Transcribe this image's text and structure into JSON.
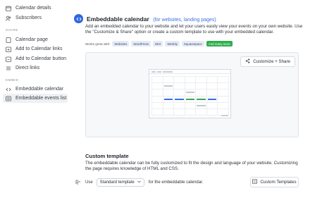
{
  "sidebar": {
    "items_top": [
      {
        "label": "Calendar details",
        "icon": "calendar-icon"
      },
      {
        "label": "Subscribers",
        "icon": "users-icon"
      }
    ],
    "share_section": "SHARE",
    "share_items": [
      {
        "label": "Calendar page",
        "icon": "page-icon"
      },
      {
        "label": "Add to Calendar links",
        "icon": "link-icon"
      },
      {
        "label": "Add to Calendar button",
        "icon": "button-icon"
      },
      {
        "label": "Direct links",
        "icon": "list-icon"
      }
    ],
    "embed_section": "EMBED",
    "embed_items": [
      {
        "label": "Embeddable calendar",
        "icon": "code-icon"
      },
      {
        "label": "Embeddable events list",
        "icon": "events-list-icon"
      }
    ]
  },
  "header": {
    "title": "Embeddable calendar",
    "subtitle": "(for websites, landing pages)",
    "description": "Add an embedded calendar to your website and let your users easily view your events on your own website. Use the \"Customize & Share\" option or create a custom template to use with your embedded calendar."
  },
  "works_with": {
    "label": "Works great with:",
    "platforms": [
      "Websites",
      "WordPress",
      "WIX",
      "Weebly",
      "Squarespace"
    ],
    "more": "And many more"
  },
  "preview": {
    "share_button": "Customize + Share"
  },
  "custom_template": {
    "title": "Custom template",
    "description": "The embeddable calendar can be fully customized to fit the design and language of your website. Customizing the page requires knowledge of HTML and CSS.",
    "use_label": "Use",
    "selected_template": "Standard template",
    "suffix": "for the embeddable calendar.",
    "button": "Custom Templates"
  },
  "colors": {
    "accent": "#2f66e0",
    "green": "#2fae4f",
    "active_bg": "#eef0f3"
  }
}
